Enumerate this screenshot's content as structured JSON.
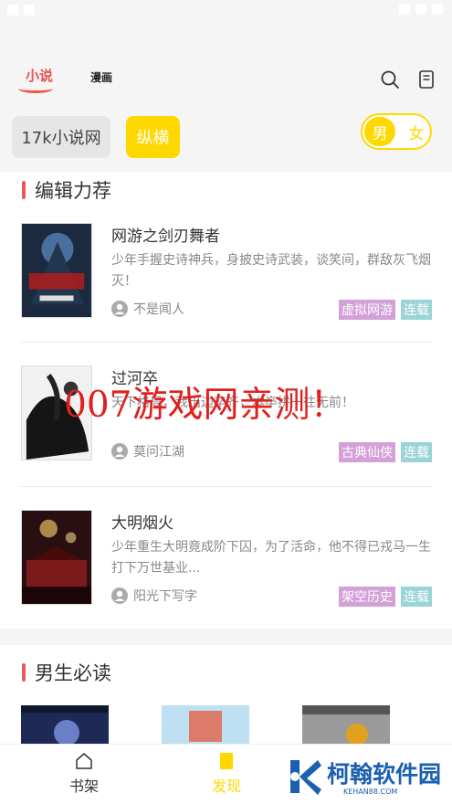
{
  "topnav": {
    "logo_text": "小说",
    "tab_manhua": "漫画",
    "search_icon": "search-icon",
    "bookshelf_icon": "bookshelf-icon"
  },
  "sources": [
    {
      "label": "17k小说网",
      "selected": false
    },
    {
      "label": "纵横",
      "selected": true
    }
  ],
  "gender": {
    "male": "男",
    "female": "女",
    "selected": "男",
    "accent": "#ffd800"
  },
  "section_editor": {
    "title": "编辑力荐",
    "books": [
      {
        "title": "网游之剑刃舞者",
        "desc": "少年手握史诗神兵，身披史诗武装，谈笑间，群敌灰飞烟灭！",
        "author": "不是闻人",
        "tags": [
          "虚拟网游",
          "连载"
        ]
      },
      {
        "title": "过河卒",
        "desc": "天下格局，我出边卒齐，本卒拼一往无前！",
        "author": "莫问江湖",
        "tags": [
          "古典仙侠",
          "连载"
        ]
      },
      {
        "title": "大明烟火",
        "desc": "少年重生大明竟成阶下囚，为了活命，他不得已戎马一生打下万世基业...",
        "author": "阳光下写字",
        "tags": [
          "架空历史",
          "连载"
        ]
      }
    ]
  },
  "section_male": {
    "title": "男生必读"
  },
  "watermark": "007游戏网亲测！",
  "bottom_nav": {
    "shelf": "书架",
    "discover": "发现",
    "active": "发现"
  },
  "brand": {
    "name": "柯翰软件园",
    "url": "KEHAN88.COM"
  },
  "colors": {
    "accent_yellow": "#ffd800",
    "section_bar": "#e85a5a",
    "tag_purple": "#d3a0d8",
    "tag_cyan": "#9bd4d6",
    "watermark_red": "#e0201e",
    "brand_blue": "#1b5fb0"
  }
}
